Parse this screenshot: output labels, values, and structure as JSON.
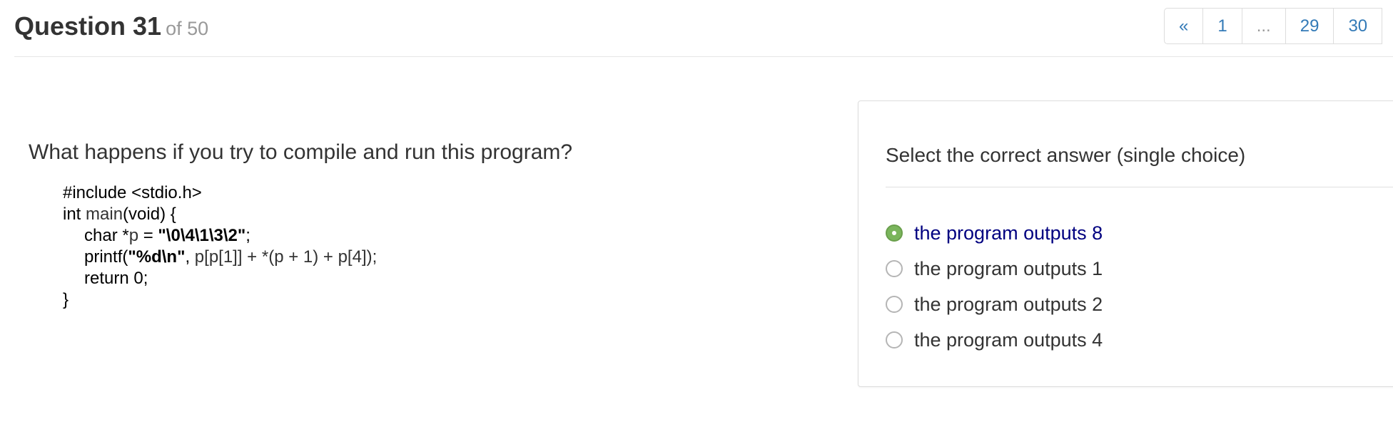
{
  "header": {
    "question_label": "Question 31",
    "question_of": "of 50"
  },
  "pagination": [
    "«",
    "1",
    "...",
    "29",
    "30"
  ],
  "question": {
    "text": "What happens if you try to compile and run this program?",
    "code": {
      "line1": "#include <stdio.h>",
      "line2_kw": "int ",
      "line2_fn": "main",
      "line2_rest": "(void) {",
      "line3_a": "char *",
      "line3_p": "p",
      "line3_b": " = ",
      "line3_str": "\"\\0\\4\\1\\3\\2\"",
      "line3_end": ";",
      "line4_a": "printf(",
      "line4_str": "\"%d\\n\"",
      "line4_b": ", ",
      "line4_p": "p[p[1]] + *(p + 1) + p[4]);",
      "line5": "return 0;",
      "line6": "}"
    }
  },
  "answer_panel": {
    "heading": "Select the correct answer (single choice)",
    "options": [
      {
        "label": "the program outputs 8",
        "selected": true
      },
      {
        "label": "the program outputs 1",
        "selected": false
      },
      {
        "label": "the program outputs 2",
        "selected": false
      },
      {
        "label": "the program outputs 4",
        "selected": false
      }
    ]
  },
  "colors": {
    "link": "#337ab7",
    "selected_radio": "#7ab55c",
    "selected_text": "#000080"
  }
}
